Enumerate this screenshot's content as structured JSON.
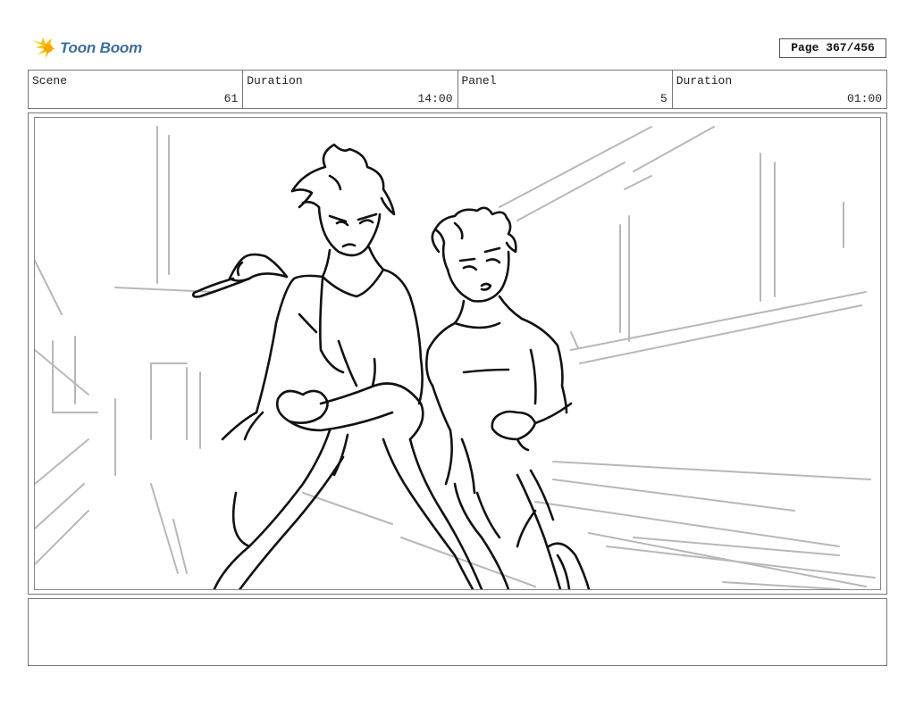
{
  "brand": {
    "name": "Toon Boom",
    "logo_color": "#f5c400",
    "text_color": "#3f6e99"
  },
  "page": {
    "label": "Page 367/456"
  },
  "info": {
    "scene_label": "Scene",
    "scene_value": "61",
    "scene_duration_label": "Duration",
    "scene_duration_value": "14:00",
    "panel_label": "Panel",
    "panel_value": "5",
    "panel_duration_label": "Duration",
    "panel_duration_value": "01:00"
  },
  "panel": {
    "image": "sketch-two-characters-in-fighting-stance"
  },
  "notes": {
    "text": ""
  }
}
